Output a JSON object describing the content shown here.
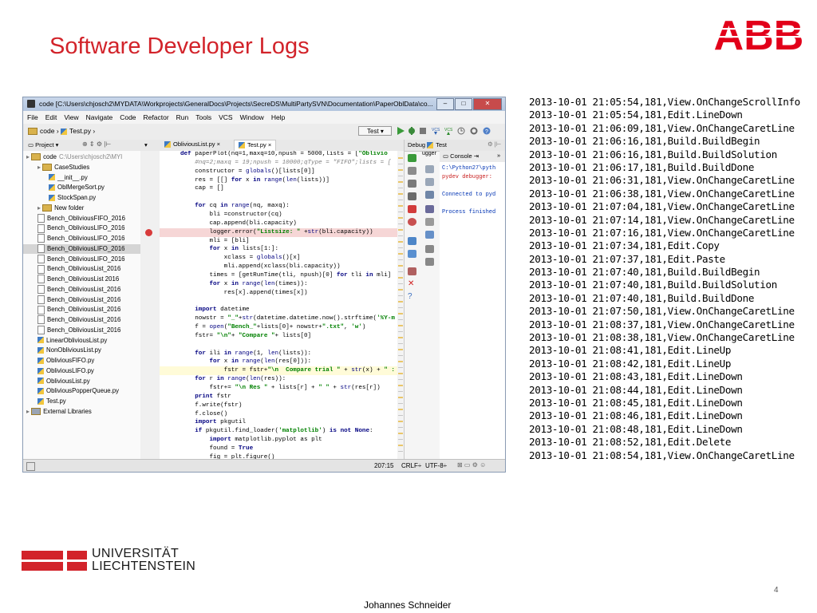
{
  "slide": {
    "title": "Software Developer Logs",
    "brand_logo": "ABB",
    "page_number": "4",
    "author": "Johannes Schneider",
    "university_line1": "UNIVERSITÄT",
    "university_line2": "LIECHTENSTEIN",
    "accent_color": "#d2232a"
  },
  "ide": {
    "window_title": "code  [C:\\Users\\chjosch2\\MYDATA\\Workprojects\\GeneralDocs\\Projects\\SecreDS\\MultiPartySVN\\Documentation\\PaperOblData\\co...",
    "menu": [
      "File",
      "Edit",
      "View",
      "Navigate",
      "Code",
      "Refactor",
      "Run",
      "Tools",
      "VCS",
      "Window",
      "Help"
    ],
    "breadcrumb": [
      "code",
      "Test.py"
    ],
    "run_config": "Test",
    "project_label": "Project",
    "tabs": [
      "ObliviousList.py",
      "Test.py"
    ],
    "debug_label": "Debug",
    "debug_run": "Test",
    "debug_tab_left": "ugger",
    "console_tab": "Console",
    "tree": [
      {
        "label": "code",
        "path": "C:\\Users\\chjosch2\\MYI",
        "indent": 0,
        "type": "folder"
      },
      {
        "label": "CaseStudies",
        "indent": 1,
        "type": "folder"
      },
      {
        "label": "__init__.py",
        "indent": 2,
        "type": "py"
      },
      {
        "label": "OblMergeSort.py",
        "indent": 2,
        "type": "py"
      },
      {
        "label": "StockSpan.py",
        "indent": 2,
        "type": "py"
      },
      {
        "label": "New folder",
        "indent": 1,
        "type": "folder"
      },
      {
        "label": "Bench_ObliviousFIFO_2016",
        "indent": 1,
        "type": "file"
      },
      {
        "label": "Bench_ObliviousLIFO_2016",
        "indent": 1,
        "type": "file"
      },
      {
        "label": "Bench_ObliviousLIFO_2016",
        "indent": 1,
        "type": "file"
      },
      {
        "label": "Bench_ObliviousLIFO_2016",
        "indent": 1,
        "type": "file",
        "selected": true
      },
      {
        "label": "Bench_ObliviousLIFO_2016",
        "indent": 1,
        "type": "file"
      },
      {
        "label": "Bench_ObliviousList_2016",
        "indent": 1,
        "type": "file"
      },
      {
        "label": "Bench_ObliviousList 2016",
        "indent": 1,
        "type": "file"
      },
      {
        "label": "Bench_ObliviousList_2016",
        "indent": 1,
        "type": "file"
      },
      {
        "label": "Bench_ObliviousList_2016",
        "indent": 1,
        "type": "file"
      },
      {
        "label": "Bench_ObliviousList_2016",
        "indent": 1,
        "type": "file"
      },
      {
        "label": "Bench_ObliviousList_2016",
        "indent": 1,
        "type": "file"
      },
      {
        "label": "Bench_ObliviousList_2016",
        "indent": 1,
        "type": "file"
      },
      {
        "label": "LinearObliviousList.py",
        "indent": 1,
        "type": "py"
      },
      {
        "label": "NonObliviousList.py",
        "indent": 1,
        "type": "py"
      },
      {
        "label": "ObliviousFIFO.py",
        "indent": 1,
        "type": "py"
      },
      {
        "label": "ObliviousLIFO.py",
        "indent": 1,
        "type": "py"
      },
      {
        "label": "ObliviousList.py",
        "indent": 1,
        "type": "py"
      },
      {
        "label": "ObliviousPopperQueue.py",
        "indent": 1,
        "type": "py"
      },
      {
        "label": "Test.py",
        "indent": 1,
        "type": "py"
      },
      {
        "label": "External Libraries",
        "indent": 0,
        "type": "lib"
      }
    ],
    "code_lines": [
      "def paperPlot(nq=1,maxq=10,npush = 5000,lists = [\"Oblivio",
      "    #nq=2;maxq = 19;npush = 10000;qType = \"FIFO\";lists = [",
      "    constructor = globals()[lists[0]]",
      "    res = [[] for x in range(len(lists))]",
      "    cap = []",
      "",
      "    for cq in range(nq, maxq):",
      "        bli =constructor(cq)",
      "        cap.append(bli.capacity)",
      "        logger.error(\"Listsize: \" +str(bli.capacity))",
      "        mli = [bli]",
      "        for x in lists[1:]:",
      "            xclass = globals()[x]",
      "            mli.append(xclass(bli.capacity))",
      "        times = [getRunTime(tli, npush)[0] for tli in mli]",
      "        for x in range(len(times)):",
      "            res[x].append(times[x])",
      "",
      "    import datetime",
      "    nowstr = \"_\"+str(datetime.datetime.now().strftime('%Y-m",
      "    f = open(\"Bench_\"+lists[0]+ nowstr+\".txt\", 'w')",
      "    fstr= \"\\n\"+ \"Compare \"+ lists[0]",
      "",
      "    for ili in range(1, len(lists)):",
      "        for x in range(len(res[0])):",
      "            fstr = fstr+\"\\n  Compare trial \" + str(x) + \" :",
      "    for r in range(len(res)):",
      "        fstr+= \"\\n Res \" + lists[r] + \" \" + str(res[r])",
      "    print fstr",
      "    f.write(fstr)",
      "    f.close()",
      "    import pkgutil",
      "    if pkgutil.find_loader('matplotlib') is not None:",
      "        import matplotlib.pyplot as plt",
      "        found = True",
      "        fig = plt.figure()"
    ],
    "console_lines": [
      "C:\\Python27\\pyth",
      "pydev debugger:",
      "",
      "Connected to pyd",
      "",
      "Process finished"
    ],
    "status": {
      "position": "207:15",
      "line_sep": "CRLF÷",
      "encoding": "UTF-8÷"
    }
  },
  "log_lines": [
    "2013-10-01 21:05:54,181,View.OnChangeScrollInfo",
    "2013-10-01 21:05:54,181,Edit.LineDown",
    "2013-10-01 21:06:09,181,View.OnChangeCaretLine",
    "2013-10-01 21:06:16,181,Build.BuildBegin",
    "2013-10-01 21:06:16,181,Build.BuildSolution",
    "2013-10-01 21:06:17,181,Build.BuildDone",
    "2013-10-01 21:06:31,181,View.OnChangeCaretLine",
    "2013-10-01 21:06:38,181,View.OnChangeCaretLine",
    "2013-10-01 21:07:04,181,View.OnChangeCaretLine",
    "2013-10-01 21:07:14,181,View.OnChangeCaretLine",
    "2013-10-01 21:07:16,181,View.OnChangeCaretLine",
    "2013-10-01 21:07:34,181,Edit.Copy",
    "2013-10-01 21:07:37,181,Edit.Paste",
    "2013-10-01 21:07:40,181,Build.BuildBegin",
    "2013-10-01 21:07:40,181,Build.BuildSolution",
    "2013-10-01 21:07:40,181,Build.BuildDone",
    "2013-10-01 21:07:50,181,View.OnChangeCaretLine",
    "2013-10-01 21:08:37,181,View.OnChangeCaretLine",
    "2013-10-01 21:08:38,181,View.OnChangeCaretLine",
    "2013-10-01 21:08:41,181,Edit.LineUp",
    "2013-10-01 21:08:42,181,Edit.LineUp",
    "2013-10-01 21:08:43,181,Edit.LineDown",
    "2013-10-01 21:08:44,181,Edit.LineDown",
    "2013-10-01 21:08:45,181,Edit.LineDown",
    "2013-10-01 21:08:46,181,Edit.LineDown",
    "2013-10-01 21:08:48,181,Edit.LineDown",
    "2013-10-01 21:08:52,181,Edit.Delete",
    "2013-10-01 21:08:54,181,View.OnChangeCaretLine"
  ]
}
